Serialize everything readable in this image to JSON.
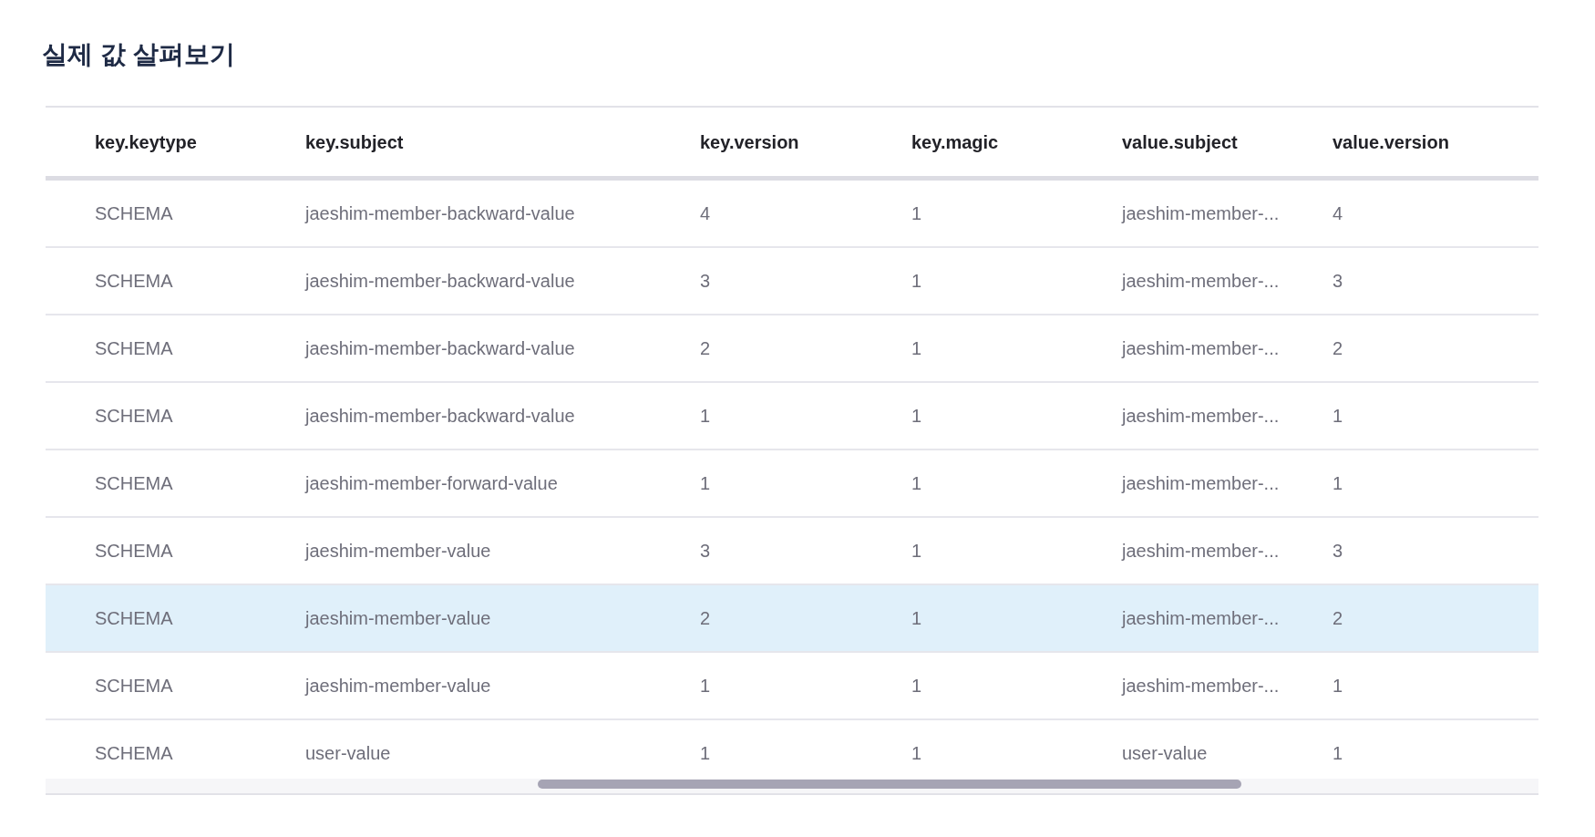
{
  "title": "실제 값 살펴보기",
  "table": {
    "columns": [
      "key.keytype",
      "key.subject",
      "key.version",
      "key.magic",
      "value.subject",
      "value.version"
    ],
    "rows": [
      {
        "cells": [
          "SCHEMA",
          "jaeshim-member-backward-value",
          "4",
          "1",
          "jaeshim-member-...",
          "4"
        ],
        "selected": false
      },
      {
        "cells": [
          "SCHEMA",
          "jaeshim-member-backward-value",
          "3",
          "1",
          "jaeshim-member-...",
          "3"
        ],
        "selected": false
      },
      {
        "cells": [
          "SCHEMA",
          "jaeshim-member-backward-value",
          "2",
          "1",
          "jaeshim-member-...",
          "2"
        ],
        "selected": false
      },
      {
        "cells": [
          "SCHEMA",
          "jaeshim-member-backward-value",
          "1",
          "1",
          "jaeshim-member-...",
          "1"
        ],
        "selected": false
      },
      {
        "cells": [
          "SCHEMA",
          "jaeshim-member-forward-value",
          "1",
          "1",
          "jaeshim-member-...",
          "1"
        ],
        "selected": false
      },
      {
        "cells": [
          "SCHEMA",
          "jaeshim-member-value",
          "3",
          "1",
          "jaeshim-member-...",
          "3"
        ],
        "selected": false
      },
      {
        "cells": [
          "SCHEMA",
          "jaeshim-member-value",
          "2",
          "1",
          "jaeshim-member-...",
          "2"
        ],
        "selected": true
      },
      {
        "cells": [
          "SCHEMA",
          "jaeshim-member-value",
          "1",
          "1",
          "jaeshim-member-...",
          "1"
        ],
        "selected": false
      },
      {
        "cells": [
          "SCHEMA",
          "user-value",
          "1",
          "1",
          "user-value",
          "1"
        ],
        "selected": false
      }
    ]
  }
}
